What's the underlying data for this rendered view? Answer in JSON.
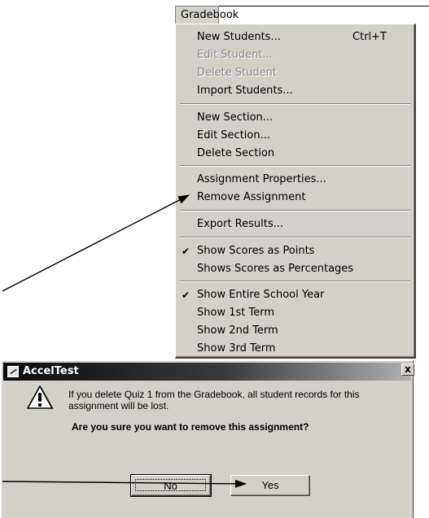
{
  "menu": {
    "title": "Gradebook",
    "items": [
      {
        "label": "New Students...",
        "shortcut": "Ctrl+T",
        "disabled": false,
        "checked": false
      },
      {
        "label": "Edit Student...",
        "shortcut": "",
        "disabled": true,
        "checked": false
      },
      {
        "label": "Delete Student",
        "shortcut": "",
        "disabled": true,
        "checked": false
      },
      {
        "label": "Import Students...",
        "shortcut": "",
        "disabled": false,
        "checked": false
      },
      {
        "label": "New Section...",
        "shortcut": "",
        "disabled": false,
        "checked": false
      },
      {
        "label": "Edit Section...",
        "shortcut": "",
        "disabled": false,
        "checked": false
      },
      {
        "label": "Delete Section",
        "shortcut": "",
        "disabled": false,
        "checked": false
      },
      {
        "label": "Assignment Properties...",
        "shortcut": "",
        "disabled": false,
        "checked": false
      },
      {
        "label": "Remove Assignment",
        "shortcut": "",
        "disabled": false,
        "checked": false
      },
      {
        "label": "Export Results...",
        "shortcut": "",
        "disabled": false,
        "checked": false
      },
      {
        "label": "Show Scores as Points",
        "shortcut": "",
        "disabled": false,
        "checked": true
      },
      {
        "label": "Shows Scores as Percentages",
        "shortcut": "",
        "disabled": false,
        "checked": false
      },
      {
        "label": "Show Entire School Year",
        "shortcut": "",
        "disabled": false,
        "checked": true
      },
      {
        "label": "Show 1st Term",
        "shortcut": "",
        "disabled": false,
        "checked": false
      },
      {
        "label": "Show 2nd Term",
        "shortcut": "",
        "disabled": false,
        "checked": false
      },
      {
        "label": "Show 3rd Term",
        "shortcut": "",
        "disabled": false,
        "checked": false
      }
    ]
  },
  "dialog": {
    "title": "AccelTest",
    "close_label": "x",
    "message": "If you delete Quiz 1 from the Gradebook, all student records for this assignment will be lost.",
    "question": "Are you sure you want to remove this assignment?",
    "no_label": "No",
    "yes_label": "Yes",
    "icon": "warning-icon"
  },
  "colors": {
    "face": "#d4d0c8",
    "titlebar_dark": "#0a0a0a",
    "disabled_text": "#8c8c8c"
  }
}
